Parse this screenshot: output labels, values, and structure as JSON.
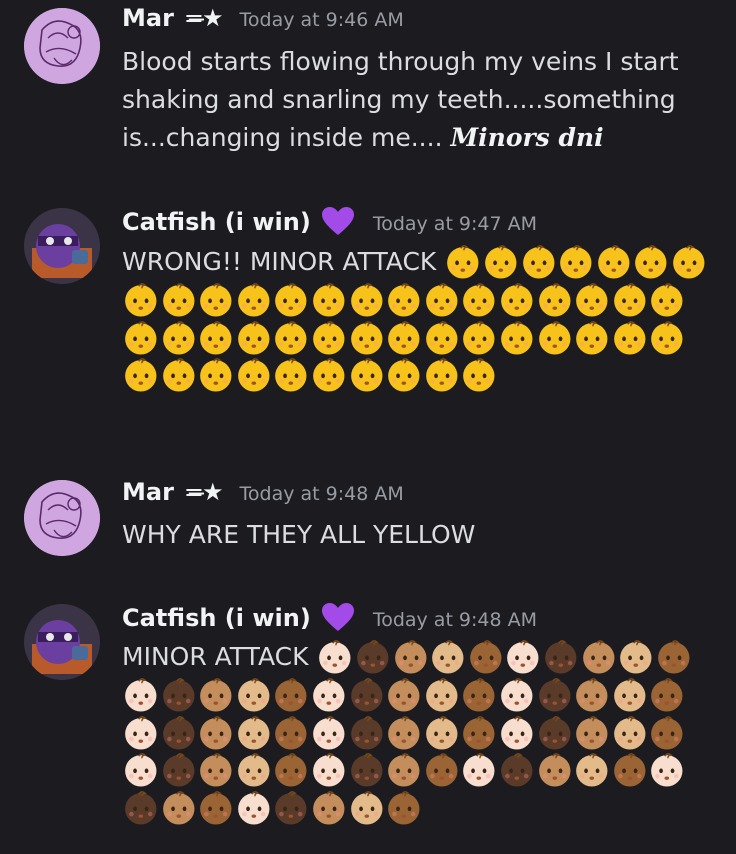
{
  "messages": [
    {
      "author": "Mar",
      "author_deco": "=̶★",
      "timestamp": "Today at 9:46 AM",
      "text": "Blood starts flowing through my veins I start shaking and snarling my teeth.....something is...changing inside me....",
      "fancy_text": "Minors dni",
      "avatar": "purple-sketch-avatar"
    },
    {
      "author": "Catfish (i win)",
      "author_badge": "purple-heart-icon",
      "timestamp": "Today at 9:47 AM",
      "text": "WRONG!! MINOR ATTACK",
      "emoji_name": "baby-emoji",
      "emoji_tones": [
        "yellow",
        "yellow",
        "yellow",
        "yellow",
        "yellow",
        "yellow",
        "yellow",
        "yellow",
        "yellow",
        "yellow",
        "yellow",
        "yellow",
        "yellow",
        "yellow",
        "yellow",
        "yellow",
        "yellow",
        "yellow",
        "yellow",
        "yellow",
        "yellow",
        "yellow",
        "yellow",
        "yellow",
        "yellow",
        "yellow",
        "yellow",
        "yellow",
        "yellow",
        "yellow",
        "yellow",
        "yellow",
        "yellow",
        "yellow",
        "yellow",
        "yellow",
        "yellow",
        "yellow",
        "yellow",
        "yellow",
        "yellow",
        "yellow",
        "yellow",
        "yellow",
        "yellow",
        "yellow",
        "yellow"
      ],
      "avatar": "ninja-turtle-avatar"
    },
    {
      "author": "Mar",
      "author_deco": "=̶★",
      "timestamp": "Today at 9:48 AM",
      "text": "WHY ARE THEY ALL YELLOW",
      "avatar": "purple-sketch-avatar"
    },
    {
      "author": "Catfish (i win)",
      "author_badge": "purple-heart-icon",
      "timestamp": "Today at 9:48 AM",
      "text": "MINOR ATTACK",
      "emoji_name": "baby-emoji",
      "emoji_tones": [
        "light",
        "dark",
        "medium",
        "medium-light",
        "medium-dark",
        "light",
        "dark",
        "medium",
        "medium-light",
        "medium-dark",
        "light",
        "dark",
        "medium",
        "medium-light",
        "medium-dark",
        "light",
        "dark",
        "medium",
        "medium-light",
        "medium-dark",
        "light",
        "dark",
        "medium",
        "medium-light",
        "medium-dark",
        "light",
        "dark",
        "medium",
        "medium-light",
        "medium-dark",
        "light",
        "dark",
        "medium",
        "medium-light",
        "medium-dark",
        "light",
        "dark",
        "medium",
        "medium-light",
        "medium-dark",
        "light",
        "dark",
        "medium",
        "medium-light",
        "medium-dark",
        "light",
        "dark",
        "medium",
        "medium-dark",
        "light",
        "dark",
        "medium",
        "medium-light",
        "medium-dark",
        "light",
        "dark",
        "medium",
        "medium-dark",
        "light",
        "dark",
        "medium",
        "medium-light",
        "medium-dark"
      ],
      "avatar": "ninja-turtle-avatar"
    }
  ],
  "tone_colors": {
    "yellow": "#f7c21a",
    "light": "#f7dece",
    "medium-light": "#e3bb8a",
    "medium": "#c48d5c",
    "medium-dark": "#9b6434",
    "dark": "#5a3a28"
  },
  "colors": {
    "background": "#1b1b20",
    "username": "#f2f3f5",
    "timestamp": "#9a9ca3",
    "heart": "#a24be8"
  }
}
